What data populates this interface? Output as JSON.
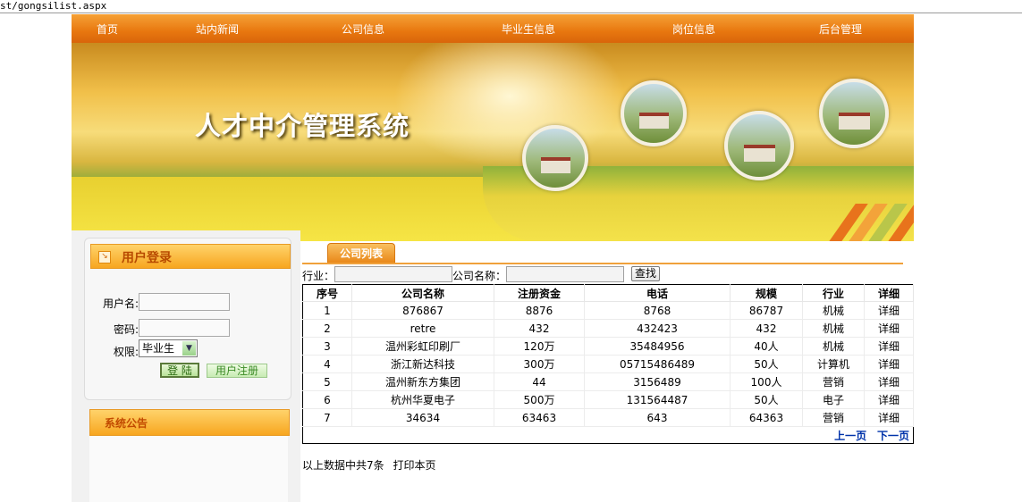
{
  "address_bar": "st/gongsilist.aspx",
  "nav": {
    "items": [
      "首页",
      "站内新闻",
      "公司信息",
      "毕业生信息",
      "岗位信息",
      "后台管理"
    ]
  },
  "banner": {
    "title": "人才中介管理系统"
  },
  "login": {
    "title": "用户登录",
    "username_label": "用户名:",
    "password_label": "密码:",
    "role_label": "权限:",
    "role_value": "毕业生",
    "login_button": "登 陆",
    "register_button": "用户注册"
  },
  "notice": {
    "title": "系统公告"
  },
  "company": {
    "tab_label": "公司列表",
    "search": {
      "industry_label": "行业：",
      "name_label": "公司名称：",
      "search_button": "查找"
    },
    "columns": [
      "序号",
      "公司名称",
      "注册资金",
      "电话",
      "规模",
      "行业",
      "详细"
    ],
    "rows": [
      [
        "1",
        "876867",
        "8876",
        "8768",
        "86787",
        "机械",
        "详细"
      ],
      [
        "2",
        "retre",
        "432",
        "432423",
        "432",
        "机械",
        "详细"
      ],
      [
        "3",
        "温州彩虹印刷厂",
        "120万",
        "35484956",
        "40人",
        "机械",
        "详细"
      ],
      [
        "4",
        "浙江新达科技",
        "300万",
        "05715486489",
        "50人",
        "计算机",
        "详细"
      ],
      [
        "5",
        "温州新东方集团",
        "44",
        "3156489",
        "100人",
        "营销",
        "详细"
      ],
      [
        "6",
        "杭州华夏电子",
        "500万",
        "131564487",
        "50人",
        "电子",
        "详细"
      ],
      [
        "7",
        "34634",
        "63463",
        "643",
        "64363",
        "营销",
        "详细"
      ]
    ],
    "pager": {
      "prev": "上一页",
      "next": "下一页"
    },
    "summary": {
      "total_text": "以上数据中共7条",
      "print": "打印本页"
    }
  }
}
